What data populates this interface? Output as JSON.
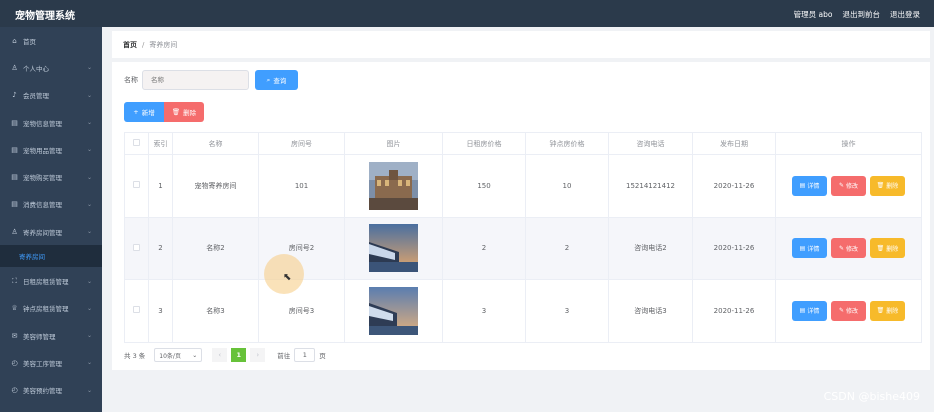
{
  "app": {
    "title": "宠物管理系统"
  },
  "header": {
    "user": "管理员 abo",
    "back_to_front": "退出到前台",
    "logout": "退出登录"
  },
  "sidebar": {
    "items": [
      {
        "label": "首页",
        "icon": "home-icon",
        "glyph": "⌂",
        "chevron": false
      },
      {
        "label": "个人中心",
        "icon": "user-icon",
        "glyph": "♙",
        "chevron": true
      },
      {
        "label": "会员管理",
        "icon": "mic-icon",
        "glyph": "♪",
        "chevron": true
      },
      {
        "label": "宠物信息管理",
        "icon": "document-icon",
        "glyph": "▤",
        "chevron": true
      },
      {
        "label": "宠物用品管理",
        "icon": "document-icon",
        "glyph": "▤",
        "chevron": true
      },
      {
        "label": "宠物购买管理",
        "icon": "document-icon",
        "glyph": "▤",
        "chevron": true
      },
      {
        "label": "消费信息管理",
        "icon": "document-icon",
        "glyph": "▤",
        "chevron": true
      },
      {
        "label": "寄养房间管理",
        "icon": "user-icon",
        "glyph": "♙",
        "chevron": true
      }
    ],
    "subitem": "寄养房间",
    "items_after": [
      {
        "label": "日租房租赁管理",
        "icon": "fullscreen-icon",
        "glyph": "⛶",
        "chevron": true
      },
      {
        "label": "钟点房租赁管理",
        "icon": "trophy-icon",
        "glyph": "♕",
        "chevron": true
      },
      {
        "label": "美容师管理",
        "icon": "mail-icon",
        "glyph": "✉",
        "chevron": true
      },
      {
        "label": "美容工序管理",
        "icon": "clock-icon",
        "glyph": "◴",
        "chevron": true
      },
      {
        "label": "美容预约管理",
        "icon": "clock-icon",
        "glyph": "◴",
        "chevron": true
      }
    ]
  },
  "breadcrumb": {
    "home": "首页",
    "separator": "/",
    "current": "寄养房间"
  },
  "search": {
    "label": "名称",
    "placeholder": "名称",
    "button": "查询"
  },
  "actions": {
    "add": "新增",
    "delete": "删除"
  },
  "table": {
    "headers": [
      "索引",
      "名称",
      "房间号",
      "图片",
      "日租房价格",
      "钟点房价格",
      "咨询电话",
      "发布日期",
      "操作"
    ],
    "rows": [
      {
        "index": "1",
        "name": "宠物寄养房间",
        "room": "101",
        "day_price": "150",
        "hour_price": "10",
        "phone": "15214121412",
        "date": "2020-11-26"
      },
      {
        "index": "2",
        "name": "名称2",
        "room": "房间号2",
        "day_price": "2",
        "hour_price": "2",
        "phone": "咨询电话2",
        "date": "2020-11-26"
      },
      {
        "index": "3",
        "name": "名称3",
        "room": "房间号3",
        "day_price": "3",
        "hour_price": "3",
        "phone": "咨询电话3",
        "date": "2020-11-26"
      }
    ],
    "ops": {
      "detail": "详情",
      "edit": "修改",
      "delete": "删除"
    }
  },
  "pagination": {
    "total": "共 3 条",
    "page_size": "10条/页",
    "current_page": "1",
    "goto_label": "前往",
    "goto_value": "1",
    "page_unit": "页"
  },
  "watermark": "CSDN @bishe409",
  "colors": {
    "primary": "#409eff",
    "danger": "#f56c6c",
    "warning": "#f7ba2a",
    "success": "#67c23a",
    "sidebar": "#304156",
    "topbar": "#2b3a4b"
  }
}
